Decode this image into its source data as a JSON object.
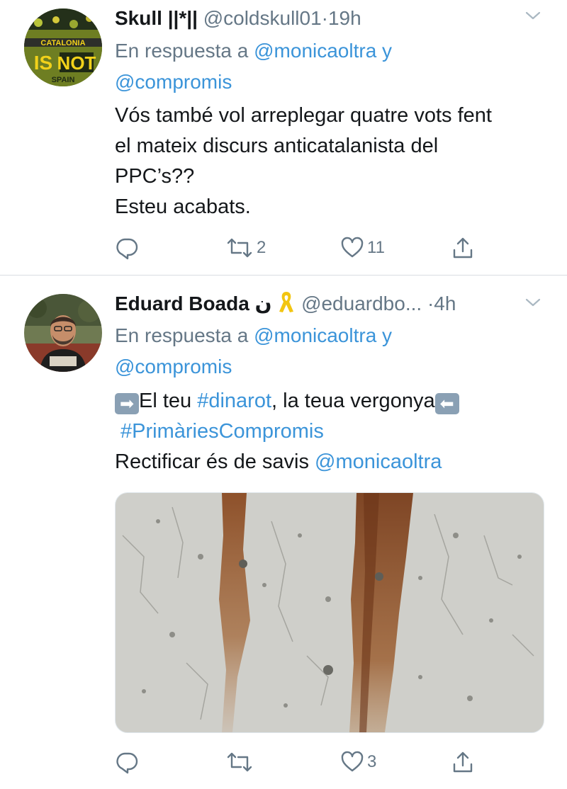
{
  "tweets": [
    {
      "display_name": "Skull ||*||",
      "handle": "@coldskull01",
      "time": "19h",
      "reply_prefix": "En respuesta a ",
      "reply_mention1": "@monicaoltra",
      "reply_and": " y",
      "reply_mention2": "@compromis",
      "avatar_text": [
        "CATALONIA",
        "IS",
        "NOT",
        "SPAIN"
      ],
      "body_lines": [
        "Vós també vol arreplegar quatre vots fent",
        "el mateix discurs anticatalanista del",
        "PPC’s??",
        "Esteu acabats."
      ],
      "retweets": "2",
      "likes": "11"
    },
    {
      "display_name": "Eduard Boada",
      "name_extra": "ن",
      "ribbon": "🎗",
      "handle": "@eduardbo...",
      "time": "4h",
      "reply_prefix": "En respuesta a ",
      "reply_mention1": "@monicaoltra",
      "reply_and": " y",
      "reply_mention2": "@compromis",
      "arrow_right": "➡",
      "body_text1": "El teu ",
      "hashtag1": "#dinarot",
      "body_text2": ", la teua vergonya",
      "arrow_left": "⬅",
      "hashtag2": "#PrimàriesCompromis",
      "body_text3": "Rectificar és de savis ",
      "mention_body": "@monicaoltra",
      "retweets": "",
      "likes": "3"
    }
  ],
  "colors": {
    "text": "#14171a",
    "secondary": "#657786",
    "link": "#3b94d9",
    "divider": "#d8dde1",
    "avatar1_bg": "#5a6a1e",
    "avatar1_text": "#f2d21a"
  },
  "icons": [
    "reply-icon",
    "retweet-icon",
    "like-icon",
    "share-icon",
    "chevron-down-icon"
  ]
}
